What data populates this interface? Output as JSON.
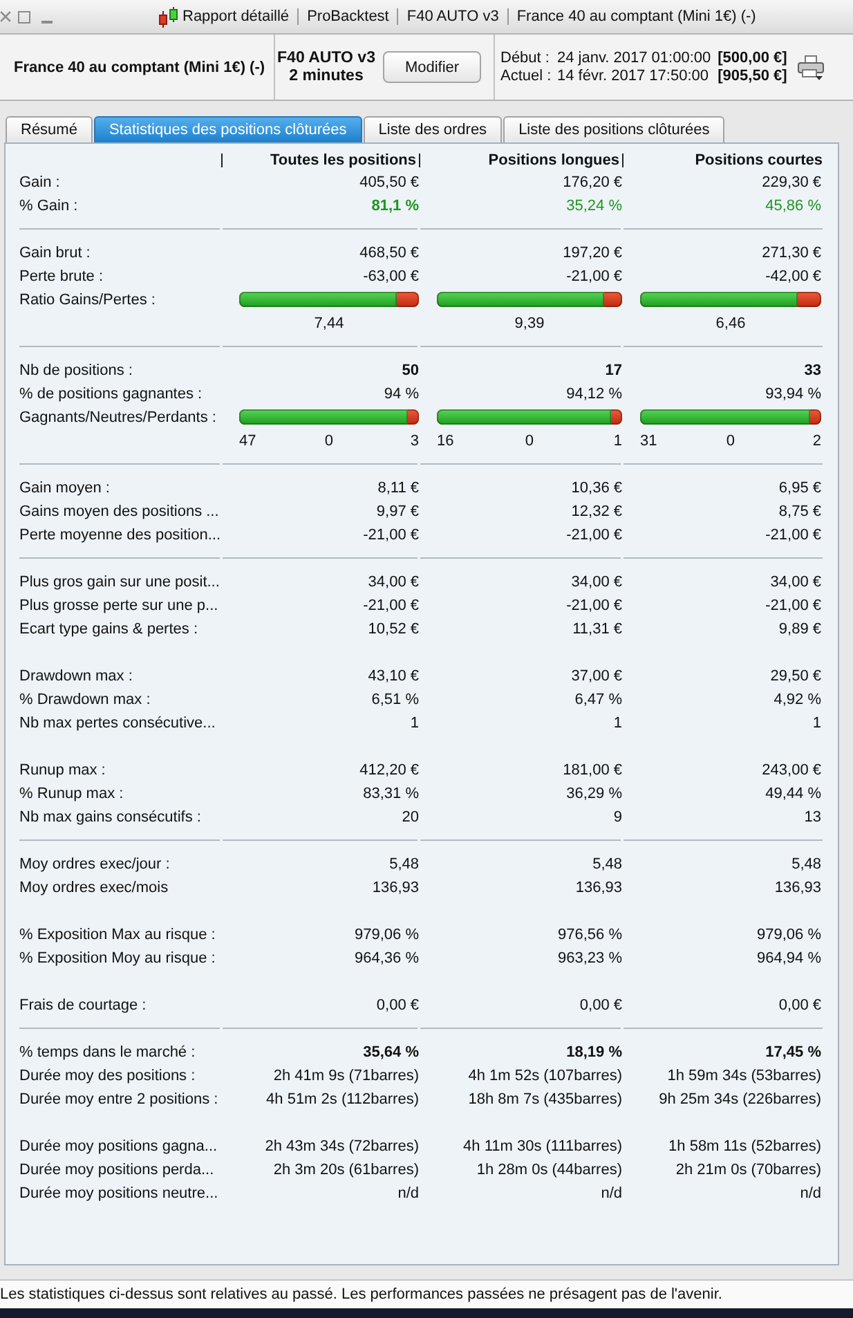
{
  "window": {
    "title_segments": [
      "Rapport détaillé",
      "ProBacktest",
      "F40 AUTO v3",
      "France 40 au comptant (Mini 1€) (-)"
    ]
  },
  "header": {
    "instrument": "France 40 au comptant (Mini 1€) (-)",
    "system": {
      "name": "F40 AUTO v3",
      "timeframe": "2 minutes"
    },
    "edit_button": "Modifier",
    "periods": [
      {
        "label": "Début :",
        "date": "24 janv. 2017 01:00:00",
        "capital": "[500,00 €]"
      },
      {
        "label": "Actuel :",
        "date": "14 févr. 2017 17:50:00",
        "capital": "[905,50 €]"
      }
    ]
  },
  "tabs": [
    {
      "label": "Résumé",
      "selected": false
    },
    {
      "label": "Statistiques des positions clôturées",
      "selected": true
    },
    {
      "label": "Liste des ordres",
      "selected": false
    },
    {
      "label": "Liste des positions clôturées",
      "selected": false
    }
  ],
  "table": {
    "columns": [
      "Toutes les positions",
      "Positions longues",
      "Positions courtes"
    ],
    "sections": [
      {
        "divider": true,
        "rows": [
          {
            "kind": "value",
            "label": "Gain :",
            "values": [
              "405,50 €",
              "176,20 €",
              "229,30 €"
            ]
          },
          {
            "kind": "value",
            "label": "% Gain :",
            "values": [
              "81,1 %",
              "35,24 %",
              "45,86 %"
            ],
            "positive": true,
            "bold": [
              true,
              false,
              false
            ]
          }
        ]
      },
      {
        "divider": true,
        "rows": [
          {
            "kind": "value",
            "label": "Gain brut :",
            "values": [
              "468,50 €",
              "197,20 €",
              "271,30 €"
            ]
          },
          {
            "kind": "value",
            "label": "Perte brute :",
            "values": [
              "-63,00 €",
              "-21,00 €",
              "-42,00 €"
            ]
          },
          {
            "kind": "bar",
            "label": "Ratio Gains/Pertes :",
            "cells": [
              {
                "level": 0.88,
                "labels": [
                  "7,44"
                ]
              },
              {
                "level": 0.9,
                "labels": [
                  "9,39"
                ]
              },
              {
                "level": 0.87,
                "labels": [
                  "6,46"
                ]
              }
            ]
          }
        ]
      },
      {
        "divider": true,
        "rows": [
          {
            "kind": "value",
            "label": "Nb de positions :",
            "values": [
              "50",
              "17",
              "33"
            ],
            "bold": [
              true,
              true,
              true
            ]
          },
          {
            "kind": "value",
            "label": "% de positions gagnantes :",
            "values": [
              "94 %",
              "94,12 %",
              "93,94 %"
            ]
          },
          {
            "kind": "bar",
            "label": "Gagnants/Neutres/Perdants :",
            "cells": [
              {
                "level": 0.94,
                "labels": [
                  "47",
                  "0",
                  "3"
                ]
              },
              {
                "level": 0.94,
                "labels": [
                  "16",
                  "0",
                  "1"
                ]
              },
              {
                "level": 0.94,
                "labels": [
                  "31",
                  "0",
                  "2"
                ]
              }
            ]
          }
        ]
      },
      {
        "divider": true,
        "rows": [
          {
            "kind": "value",
            "label": "Gain moyen :",
            "values": [
              "8,11 €",
              "10,36 €",
              "6,95 €"
            ]
          },
          {
            "kind": "value",
            "label": "Gains moyen des positions ...",
            "values": [
              "9,97 €",
              "12,32 €",
              "8,75 €"
            ]
          },
          {
            "kind": "value",
            "label": "Perte moyenne des position...",
            "values": [
              "-21,00 €",
              "-21,00 €",
              "-21,00 €"
            ]
          }
        ]
      },
      {
        "divider": false,
        "rows": [
          {
            "kind": "value",
            "label": "Plus gros gain sur une posit...",
            "values": [
              "34,00 €",
              "34,00 €",
              "34,00 €"
            ]
          },
          {
            "kind": "value",
            "label": "Plus grosse perte sur une p...",
            "values": [
              "-21,00 €",
              "-21,00 €",
              "-21,00 €"
            ]
          },
          {
            "kind": "value",
            "label": "Ecart type gains & pertes :",
            "values": [
              "10,52 €",
              "11,31 €",
              "9,89 €"
            ]
          }
        ]
      },
      {
        "divider": false,
        "rows": [
          {
            "kind": "value",
            "label": "Drawdown max :",
            "values": [
              "43,10 €",
              "37,00 €",
              "29,50 €"
            ]
          },
          {
            "kind": "value",
            "label": "% Drawdown max :",
            "values": [
              "6,51 %",
              "6,47 %",
              "4,92 %"
            ]
          },
          {
            "kind": "value",
            "label": "Nb max pertes consécutive...",
            "values": [
              "1",
              "1",
              "1"
            ]
          }
        ]
      },
      {
        "divider": true,
        "rows": [
          {
            "kind": "value",
            "label": "Runup max :",
            "values": [
              "412,20 €",
              "181,00 €",
              "243,00 €"
            ]
          },
          {
            "kind": "value",
            "label": "% Runup max :",
            "values": [
              "83,31 %",
              "36,29 %",
              "49,44 %"
            ]
          },
          {
            "kind": "value",
            "label": "Nb max gains consécutifs :",
            "values": [
              "20",
              "9",
              "13"
            ]
          }
        ]
      },
      {
        "divider": false,
        "rows": [
          {
            "kind": "value",
            "label": "Moy ordres exec/jour :",
            "values": [
              "5,48",
              "5,48",
              "5,48"
            ]
          },
          {
            "kind": "value",
            "label": "Moy ordres exec/mois",
            "values": [
              "136,93",
              "136,93",
              "136,93"
            ]
          }
        ]
      },
      {
        "divider": false,
        "rows": [
          {
            "kind": "value",
            "label": "% Exposition Max au risque :",
            "values": [
              "979,06 %",
              "976,56 %",
              "979,06 %"
            ]
          },
          {
            "kind": "value",
            "label": "% Exposition Moy au risque :",
            "values": [
              "964,36 %",
              "963,23 %",
              "964,94 %"
            ]
          }
        ]
      },
      {
        "divider": true,
        "rows": [
          {
            "kind": "value",
            "label": "Frais de courtage :",
            "values": [
              "0,00 €",
              "0,00 €",
              "0,00 €"
            ]
          }
        ]
      },
      {
        "divider": false,
        "rows": [
          {
            "kind": "value",
            "label": "% temps dans le marché :",
            "values": [
              "35,64 %",
              "18,19 %",
              "17,45 %"
            ],
            "bold": [
              true,
              true,
              true
            ]
          },
          {
            "kind": "value",
            "label": "Durée moy des positions :",
            "values": [
              "2h 41m 9s (71barres)",
              "4h 1m 52s (107barres)",
              "1h 59m 34s (53barres)"
            ]
          },
          {
            "kind": "value",
            "label": "Durée moy entre 2 positions :",
            "values": [
              "4h 51m 2s (112barres)",
              "18h 8m 7s (435barres)",
              "9h 25m 34s (226barres)"
            ]
          }
        ]
      },
      {
        "rows": [
          {
            "kind": "value",
            "label": "Durée moy positions gagna...",
            "values": [
              "2h 43m 34s (72barres)",
              "4h 11m 30s (111barres)",
              "1h 58m 11s (52barres)"
            ]
          },
          {
            "kind": "value",
            "label": "Durée moy positions perda...",
            "values": [
              "2h 3m 20s (61barres)",
              "1h 28m 0s (44barres)",
              "2h 21m 0s (70barres)"
            ]
          },
          {
            "kind": "value",
            "label": "Durée moy positions neutre...",
            "values": [
              "n/d",
              "n/d",
              "n/d"
            ]
          }
        ]
      }
    ]
  },
  "disclaimer": "Les statistiques ci-dessus sont relatives au passé. Les performances passées ne présagent pas de l'avenir."
}
